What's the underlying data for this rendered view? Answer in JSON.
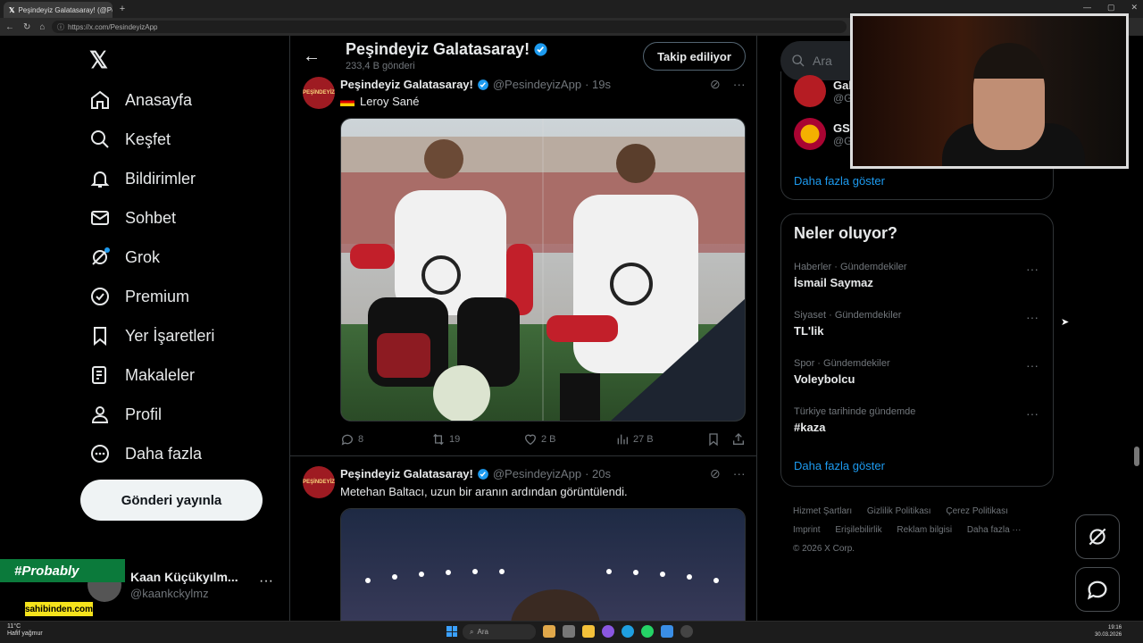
{
  "browser": {
    "tab_title": "Peşindeyiz Galatasaray! (@Pesind...",
    "url": "https://x.com/PesindeyizApp"
  },
  "nav": {
    "items": [
      {
        "label": "Anasayfa",
        "icon": "home-icon"
      },
      {
        "label": "Keşfet",
        "icon": "search-icon"
      },
      {
        "label": "Bildirimler",
        "icon": "bell-icon"
      },
      {
        "label": "Sohbet",
        "icon": "mail-icon"
      },
      {
        "label": "Grok",
        "icon": "grok-icon"
      },
      {
        "label": "Premium",
        "icon": "verified-icon"
      },
      {
        "label": "Yer İşaretleri",
        "icon": "bookmark-icon"
      },
      {
        "label": "Makaleler",
        "icon": "article-icon"
      },
      {
        "label": "Profil",
        "icon": "person-icon"
      },
      {
        "label": "Daha fazla",
        "icon": "more-circle-icon"
      }
    ],
    "post_button": "Gönderi yayınla",
    "account": {
      "name": "Kaan Küçükyılm...",
      "handle": "@kaankckylmz"
    },
    "promo_tag": "#Probably",
    "promo_sponsor": "sahibinden.com"
  },
  "profile_header": {
    "title": "Peşindeyiz Galatasaray!",
    "post_count": "233,4 B gönderi",
    "follow_button": "Takip ediliyor"
  },
  "tweets": [
    {
      "name": "Peşindeyiz Galatasaray!",
      "handle": "@PesindeyizApp",
      "time": "· 19s",
      "text": "Leroy Sané",
      "replies": "8",
      "retweets": "19",
      "likes": "2 B",
      "views": "27 B"
    },
    {
      "name": "Peşindeyiz Galatasaray!",
      "handle": "@PesindeyizApp",
      "time": "· 20s",
      "text": "Metehan Baltacı, uzun bir aranın ardından görüntülendi."
    }
  ],
  "sidebar": {
    "search_placeholder": "Ara",
    "who_to_follow": [
      {
        "name": "Gal...",
        "handle": "@G..."
      },
      {
        "name": "GST...",
        "handle": "@G..."
      }
    ],
    "show_more": "Daha fazla göster",
    "trends_title": "Neler oluyor?",
    "trends": [
      {
        "category": "Haberler · Gündemdekiler",
        "title": "İsmail Saymaz"
      },
      {
        "category": "Siyaset · Gündemdekiler",
        "title": "TL'lik"
      },
      {
        "category": "Spor · Gündemdekiler",
        "title": "Voleybolcu"
      },
      {
        "category": "Türkiye tarihinde gündemde",
        "title": "#kaza"
      }
    ],
    "trends_show_more": "Daha fazla göster",
    "footer": [
      "Hizmet Şartları",
      "Gizlilik Politikası",
      "Çerez Politikası",
      "Imprint",
      "Erişilebilirlik",
      "Reklam bilgisi",
      "Daha fazla ···",
      "© 2026 X Corp."
    ]
  },
  "taskbar": {
    "weather_temp": "11°C",
    "weather_desc": "Hafif yağmur",
    "search": "Ara",
    "time": "19:16",
    "date": "30.03.2026"
  },
  "colors": {
    "accent": "#1d9bf0",
    "background": "#000000",
    "text": "#e7e9ea",
    "muted": "#71767b"
  }
}
